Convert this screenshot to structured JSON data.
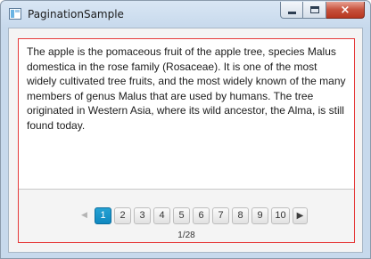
{
  "window": {
    "title": "PaginationSample",
    "close_glyph": "×"
  },
  "page": {
    "text": "The apple is the pomaceous fruit of the apple tree, species Malus domestica in the rose family (Rosaceae). It is one of the most widely cultivated tree fruits, and the most widely known of the many members of genus Malus that are used by humans. The tree originated in Western Asia, where its wild ancestor, the Alma, is still found today."
  },
  "pagination": {
    "prev_glyph": "◀",
    "next_glyph": "▶",
    "buttons": [
      "1",
      "2",
      "3",
      "4",
      "5",
      "6",
      "7",
      "8",
      "9",
      "10"
    ],
    "selected": "1",
    "page_info": "1/28"
  },
  "colors": {
    "accent": "#1a95cc",
    "frame": "#e53a3a"
  }
}
